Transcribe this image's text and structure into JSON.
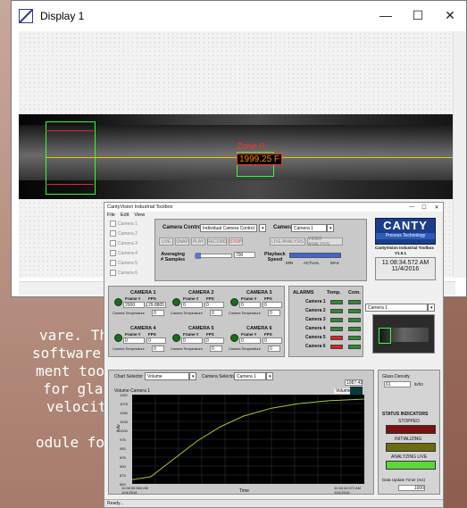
{
  "background_doc": {
    "lines": [
      {
        "text": "vare. The"
      },
      {
        "text": "software"
      },
      {
        "text": "ment tools"
      },
      {
        "text": "for  glass"
      },
      {
        "text": "velocity."
      },
      {
        "text": "odule for"
      }
    ]
  },
  "display_window": {
    "title": "Display 1",
    "controls": {
      "minimize": "—",
      "maximize": "☐",
      "close": "✕"
    },
    "zone_label": "Zone 0",
    "zone_value": "1999.25  F"
  },
  "app": {
    "title": "CantyVision Industrial Toolbox",
    "menu": [
      "File",
      "Edit",
      "View"
    ],
    "camera_list": [
      "Camera 1",
      "Camera 2",
      "Camera 3",
      "Camera 4",
      "Camera 5",
      "Camera 6"
    ],
    "camera_control_label": "Camera Control",
    "camera_control_value": "Individual Camera Control",
    "camera_label": "Camera",
    "camera_value": "Camera 1",
    "buttons": [
      "LIVE",
      "SNAP",
      "PLAY",
      "RECORD",
      "STOP"
    ],
    "analysis_buttons": [
      "LIVE ANALYSIS",
      "VIDEO ANALYSIS"
    ],
    "averaging_label": "Averaging\n# Samples",
    "averaging_value": "700",
    "playback_label": "Playback\nSpeed",
    "playback_scale": [
      "MIN",
      "ACTUAL",
      "MAX"
    ],
    "logo": {
      "name": "CANTY",
      "tagline": "Process Technology"
    },
    "version_title": "CantyVision Industrial Toolbox",
    "version": "V1.5.1",
    "clock_time": "11:08:34.572 AM",
    "clock_date": "11/4/2016",
    "right_camera_select": "Camera 1",
    "cameras": [
      {
        "name": "CAMERA 1",
        "frame": "2000",
        "fps": "29.8805",
        "temp": "0"
      },
      {
        "name": "CAMERA 2",
        "frame": "0",
        "fps": "0",
        "temp": "0"
      },
      {
        "name": "CAMERA 3",
        "frame": "0",
        "fps": "0",
        "temp": "0"
      },
      {
        "name": "CAMERA 4",
        "frame": "0",
        "fps": "0",
        "temp": "0"
      },
      {
        "name": "CAMERA 5",
        "frame": "0",
        "fps": "0",
        "temp": "0"
      },
      {
        "name": "CAMERA 6",
        "frame": "0",
        "fps": "0",
        "temp": "0"
      }
    ],
    "frame_label": "Frame #",
    "fps_label": "FPS",
    "cam_temp_label": "Camera Temperature",
    "alarms": {
      "header": "ALARMS",
      "temp": "Temp.",
      "com": "Com.",
      "rows": [
        {
          "name": "Camera 1",
          "temp_color": "#2e8b2e",
          "com_color": "#2e8b2e"
        },
        {
          "name": "Camera 2",
          "temp_color": "#2e8b2e",
          "com_color": "#2e8b2e"
        },
        {
          "name": "Camera 3",
          "temp_color": "#2e8b2e",
          "com_color": "#2e8b2e"
        },
        {
          "name": "Camera 4",
          "temp_color": "#2e8b2e",
          "com_color": "#2e8b2e"
        },
        {
          "name": "Camera 5",
          "temp_color": "#e02020",
          "com_color": "#2e8b2e"
        },
        {
          "name": "Camera 6",
          "temp_color": "#e02020",
          "com_color": "#2e8b2e"
        }
      ]
    },
    "chart_selector_label": "Chart Selector",
    "chart_selector_value": "Volume",
    "camera_selector_label": "Camera Selector",
    "camera_selector_value": "Camera 1",
    "chart_title": "Volume Camera 1",
    "chart_legend": "Volume",
    "chart_readout": "1087.43",
    "chart_y_label": "lb/hr",
    "chart_x_label": "Time",
    "chart_x_start": "11:08:05.584 AM\n11/4/2016",
    "chart_x_end": "11:08:34.572 AM\n11/4/2016",
    "glass_density_label": "Glass Density",
    "glass_density_value": "61",
    "glass_density_unit": "lb/ft3",
    "status_title": "STATUS INDICATORS",
    "status_items": [
      "STOPPED",
      "INITIALIZING",
      "ANALYZING LIVE"
    ],
    "data_update_label": "Data Update Timer (ms)",
    "data_update_value": "1000",
    "status_text": "Ready..."
  },
  "chart_data": {
    "type": "line",
    "title": "Volume Camera 1",
    "xlabel": "Time",
    "ylabel": "lb/hr",
    "y_ticks": [
      850,
      875,
      900,
      925,
      950,
      975,
      1000,
      1025,
      1050,
      1075,
      1100
    ],
    "ylim": [
      850,
      1100
    ],
    "series": [
      {
        "name": "Volume",
        "color": "#9acd32",
        "points": [
          [
            0,
            862
          ],
          [
            0.08,
            870
          ],
          [
            0.18,
            920
          ],
          [
            0.28,
            970
          ],
          [
            0.38,
            1010
          ],
          [
            0.48,
            1040
          ],
          [
            0.6,
            1062
          ],
          [
            0.72,
            1075
          ],
          [
            0.85,
            1083
          ],
          [
            1.0,
            1087.43
          ]
        ]
      }
    ]
  },
  "colors": {
    "logo_blue": "#1c3e8a",
    "plot_line": "#9acd32",
    "stop_red": "#e03030"
  }
}
